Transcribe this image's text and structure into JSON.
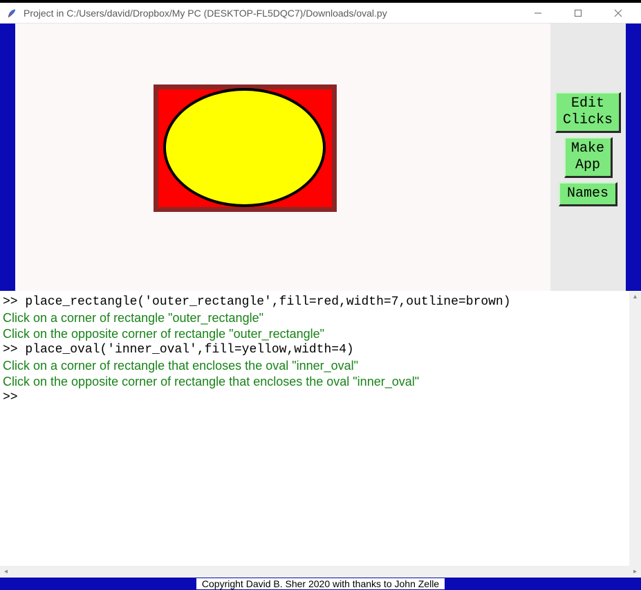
{
  "window": {
    "title": "Project in C:/Users/david/Dropbox/My PC (DESKTOP-FL5DQC7)/Downloads/oval.py"
  },
  "buttons": {
    "edit_clicks": "Edit\nClicks",
    "make_app": "Make\nApp",
    "names": "Names"
  },
  "canvas": {
    "rect_fill": "red",
    "rect_outline": "brown",
    "rect_width": 7,
    "oval_fill": "yellow",
    "oval_width": 4
  },
  "console": {
    "lines": [
      {
        "type": "cmd",
        "text": ">> place_rectangle('outer_rectangle',fill=red,width=7,outline=brown)"
      },
      {
        "type": "hint",
        "text": "Click on a corner of rectangle \"outer_rectangle\""
      },
      {
        "type": "hint",
        "text": "Click on the opposite corner of rectangle \"outer_rectangle\""
      },
      {
        "type": "cmd",
        "text": ">> place_oval('inner_oval',fill=yellow,width=4)"
      },
      {
        "type": "hint",
        "text": "Click on a corner of rectangle that encloses the oval \"inner_oval\""
      },
      {
        "type": "hint",
        "text": "Click on the opposite corner of rectangle that encloses the oval \"inner_oval\""
      },
      {
        "type": "cmd",
        "text": ">>"
      }
    ]
  },
  "footer": {
    "copyright": "Copyright David B. Sher 2020 with thanks to John Zelle"
  }
}
